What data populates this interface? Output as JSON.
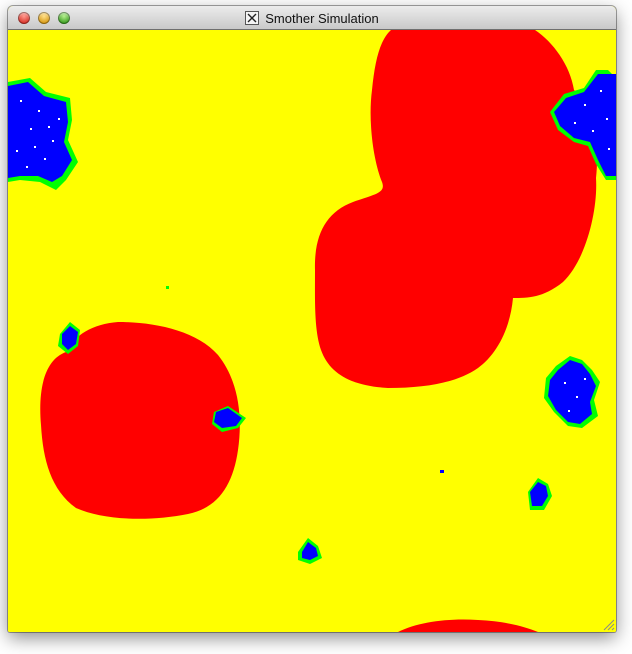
{
  "window": {
    "title": "Smother Simulation",
    "icon": "x11-icon"
  },
  "controls": {
    "close": "close-button",
    "minimize": "minimize-button",
    "zoom": "zoom-button"
  },
  "simulation": {
    "colors": {
      "background": "#ffff00",
      "red_region": "#ff0000",
      "blue_cluster": "#0000ff",
      "green_edge": "#00ff00",
      "speckle": "#ffffff"
    }
  }
}
